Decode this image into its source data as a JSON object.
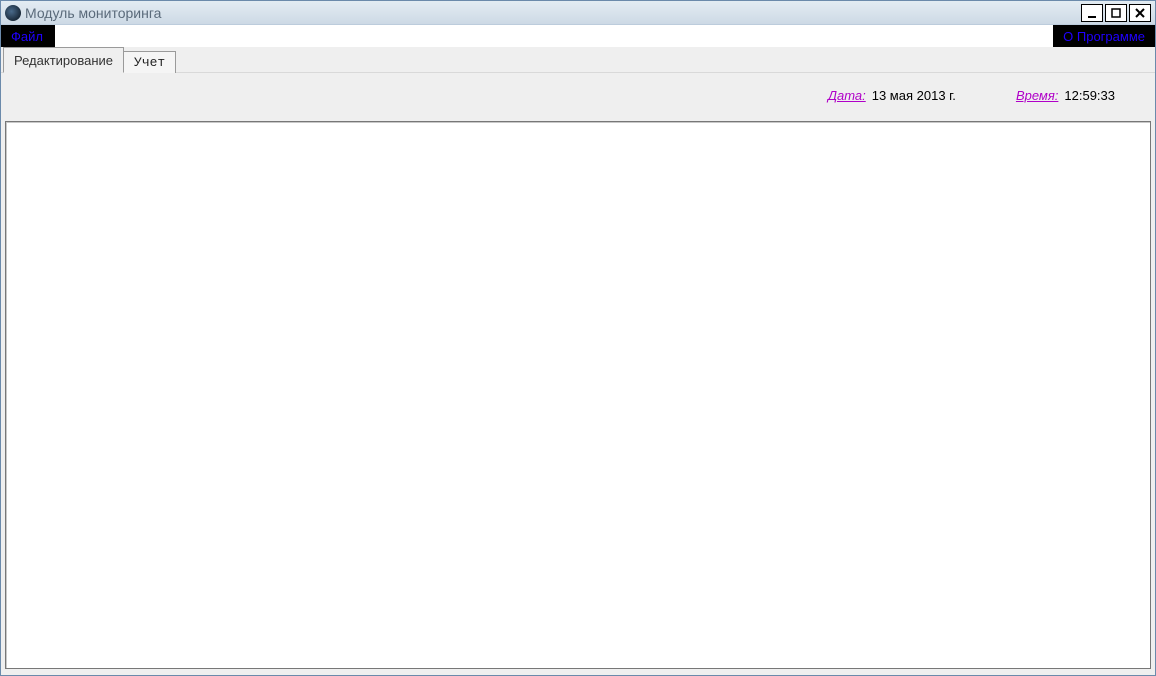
{
  "window": {
    "title": "Модуль мониторинга"
  },
  "menu": {
    "file": "Файл",
    "about": "О Программе"
  },
  "tabs": {
    "edit": "Редактирование",
    "account": "Учет"
  },
  "status": {
    "date_label": "Дата:",
    "date_value": "13 мая 2013 г.",
    "time_label": "Время:",
    "time_value": "12:59:33"
  }
}
